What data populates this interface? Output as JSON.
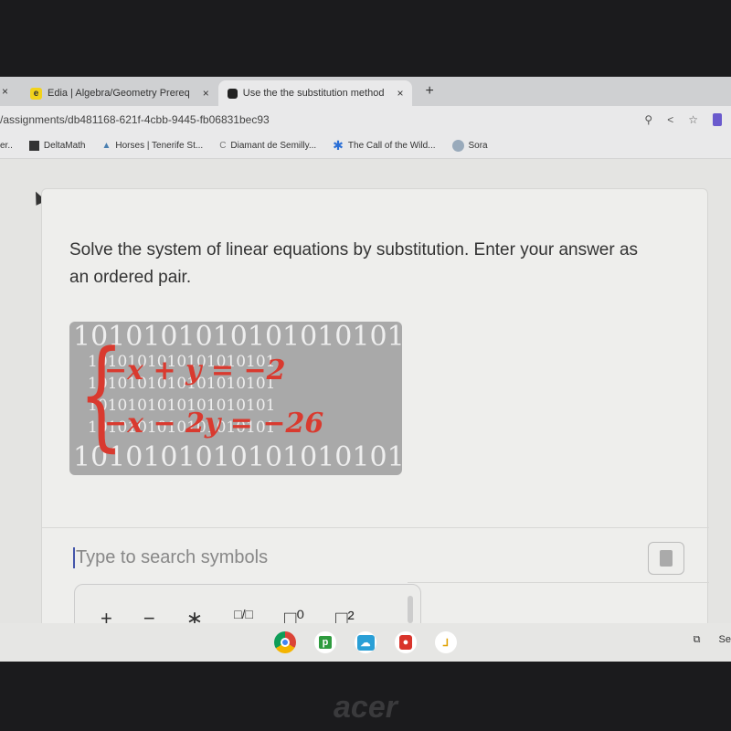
{
  "browser": {
    "tabs": [
      {
        "label": "Edia | Algebra/Geometry Prereq",
        "favicon": "e",
        "active": false
      },
      {
        "label": "Use the the substitution method",
        "favicon": "square",
        "active": true
      }
    ],
    "new_tab": "+",
    "close": "×",
    "url": "/assignments/db481168-621f-4cbb-9445-fb06831bec93",
    "bookmarks": [
      "er..",
      "DeltaMath",
      "Horses | Tenerife St...",
      "Diamant de Semilly...",
      "The Call of the Wild...",
      "Sora"
    ]
  },
  "question": {
    "text": "Solve the system of linear equations by substitution. Enter your answer as an ordered pair.",
    "equations": [
      "−x + y = −2",
      "−x − 2y = −26"
    ],
    "equation_color": "#d93a2f",
    "background_pattern": "1010101010101010101"
  },
  "answer": {
    "placeholder": "Type to search symbols"
  },
  "symbols": [
    "+",
    "−",
    "∗",
    "□/□",
    "□⁰",
    "□²"
  ],
  "shelf": {
    "apps": [
      "chrome",
      "p",
      "cloud",
      "record",
      "stylus"
    ],
    "right_label": "Se"
  },
  "bezel_logo": "acer"
}
